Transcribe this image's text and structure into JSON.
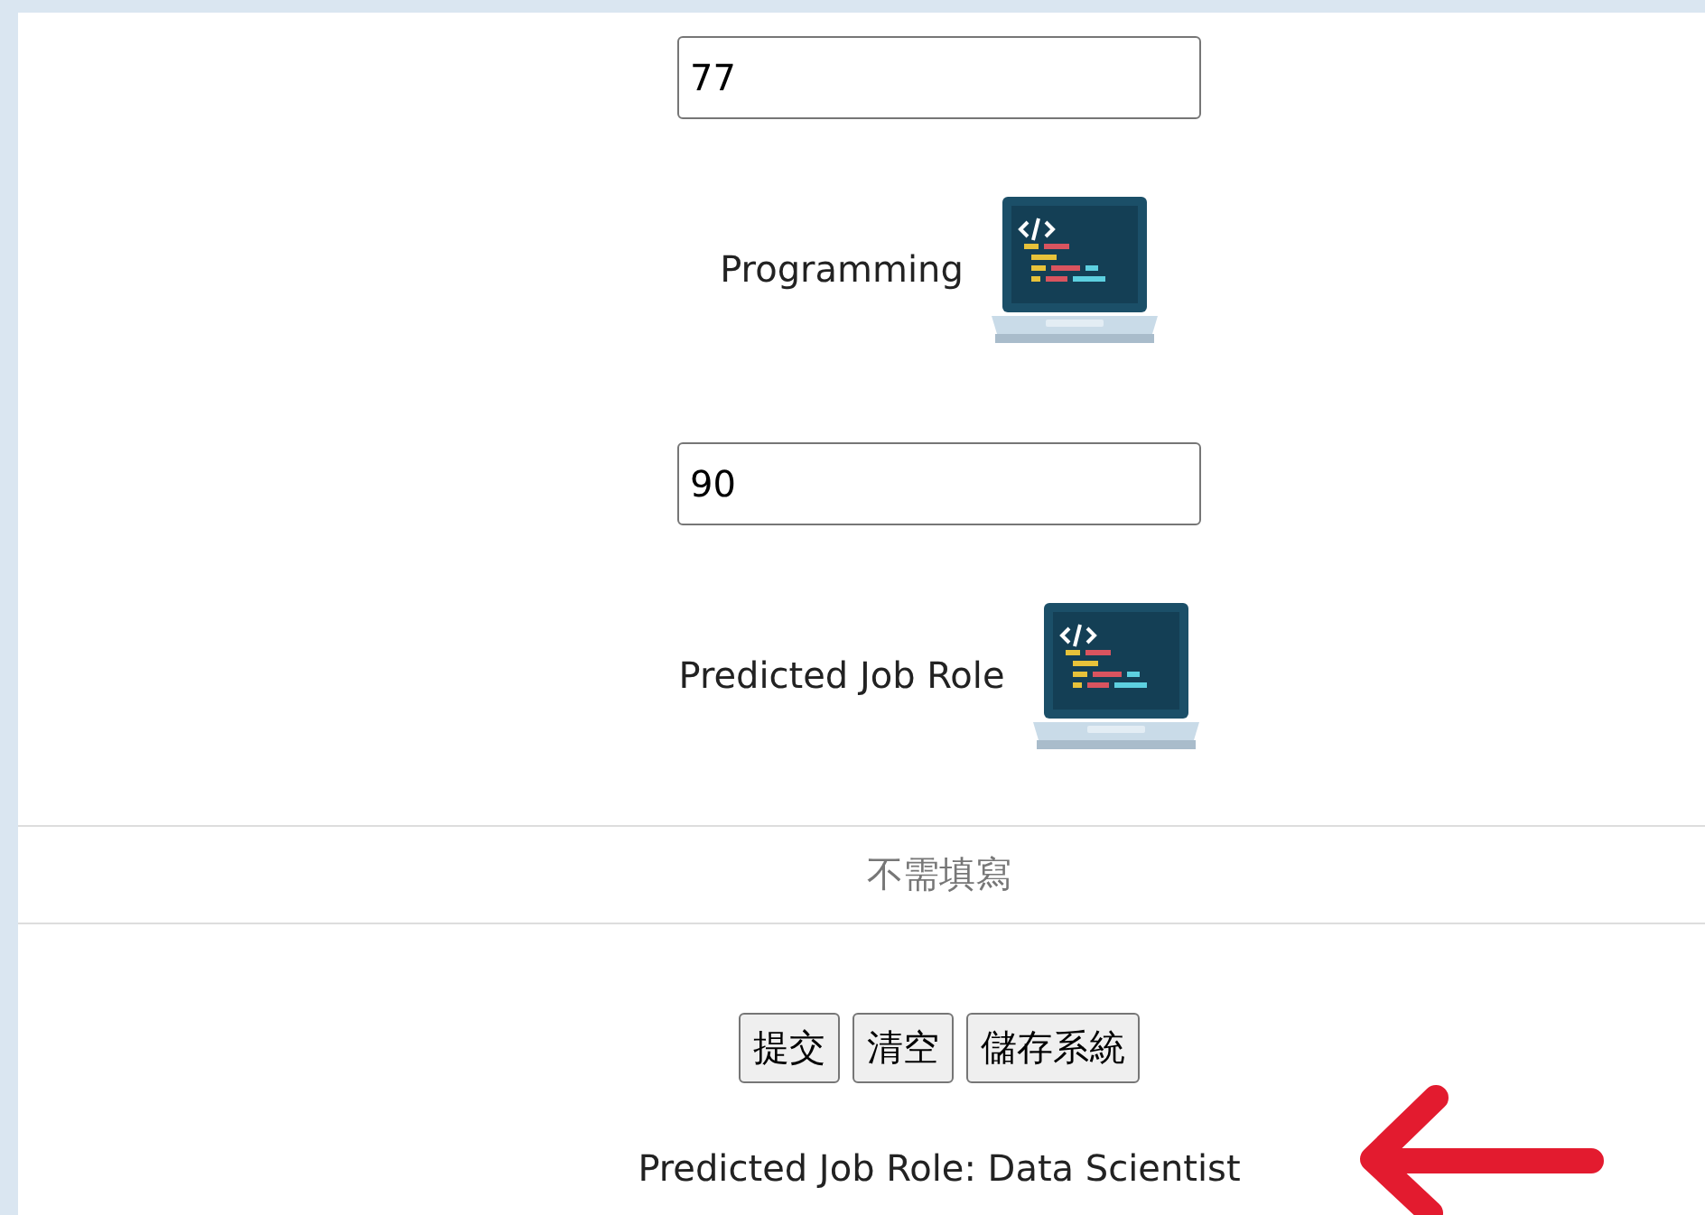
{
  "fields": [
    {
      "kind": "input",
      "value": "77"
    },
    {
      "kind": "label",
      "label": "Programming"
    },
    {
      "kind": "input",
      "value": "90"
    },
    {
      "kind": "label",
      "label": "Predicted Job Role"
    }
  ],
  "note": "不需填寫",
  "buttons": [
    "提交",
    "清空",
    "儲存系統"
  ],
  "result": "Predicted Job Role: Data Scientist",
  "annotation": {
    "kind": "arrow",
    "color": "#e31b2f"
  }
}
